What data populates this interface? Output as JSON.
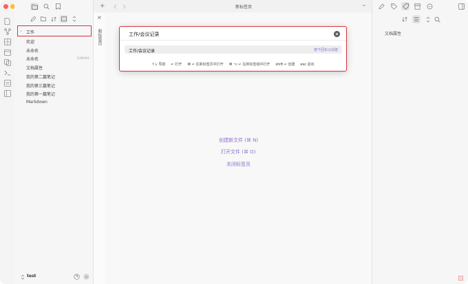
{
  "colors": {
    "accent": "#8b6fd3",
    "highlight": "#d3343a",
    "close": "#ff5f57",
    "minimize": "#febc2e",
    "maximize": "#28c840"
  },
  "window": {
    "tab_title": "新标签页",
    "vertical_tab_label": "新标签页",
    "new_tab_symbol": "+",
    "close_symbol": "×",
    "chevron_symbol": "⌄"
  },
  "sidebar": {
    "items": [
      {
        "label": "工作",
        "badge": ""
      },
      {
        "label": "欢迎",
        "badge": ""
      },
      {
        "label": "未命名",
        "badge": ""
      },
      {
        "label": "未命名",
        "badge": "CANVAS"
      },
      {
        "label": "文档属性",
        "badge": ""
      },
      {
        "label": "我的第二篇笔记",
        "badge": ""
      },
      {
        "label": "我的第三篇笔记",
        "badge": ""
      },
      {
        "label": "我的第一篇笔记",
        "badge": ""
      },
      {
        "label": "Markdown",
        "badge": ""
      }
    ],
    "vault_name": "test",
    "collapsed_arrow": "›"
  },
  "modal": {
    "input_value": "工作/会议记录",
    "suggestion": "工作/会议记录",
    "suggestion_hint": "按下回车以创建",
    "instructions": [
      {
        "key": "↑↓",
        "label": "导航"
      },
      {
        "key": "↵",
        "label": "打开"
      },
      {
        "key": "⌘ ↵",
        "label": "在新标签页中打开"
      },
      {
        "key": "⌘ ⌥ ↵",
        "label": "在新标签组中打开"
      },
      {
        "key": "shift ↵",
        "label": "创建"
      },
      {
        "key": "esc",
        "label": "退出"
      }
    ]
  },
  "main": {
    "actions": [
      {
        "label": "创建新文件 (⌘ N)"
      },
      {
        "label": "打开文件 (⌘ O)"
      },
      {
        "label": "关闭标签页"
      }
    ]
  },
  "right_panel": {
    "title": "文档属性"
  },
  "icons": {
    "ribbon": [
      "files-icon",
      "graph-icon",
      "canvas-icon",
      "calendar-icon",
      "template-icon",
      "terminal-icon",
      "list-icon",
      "sidebar-icon"
    ]
  }
}
